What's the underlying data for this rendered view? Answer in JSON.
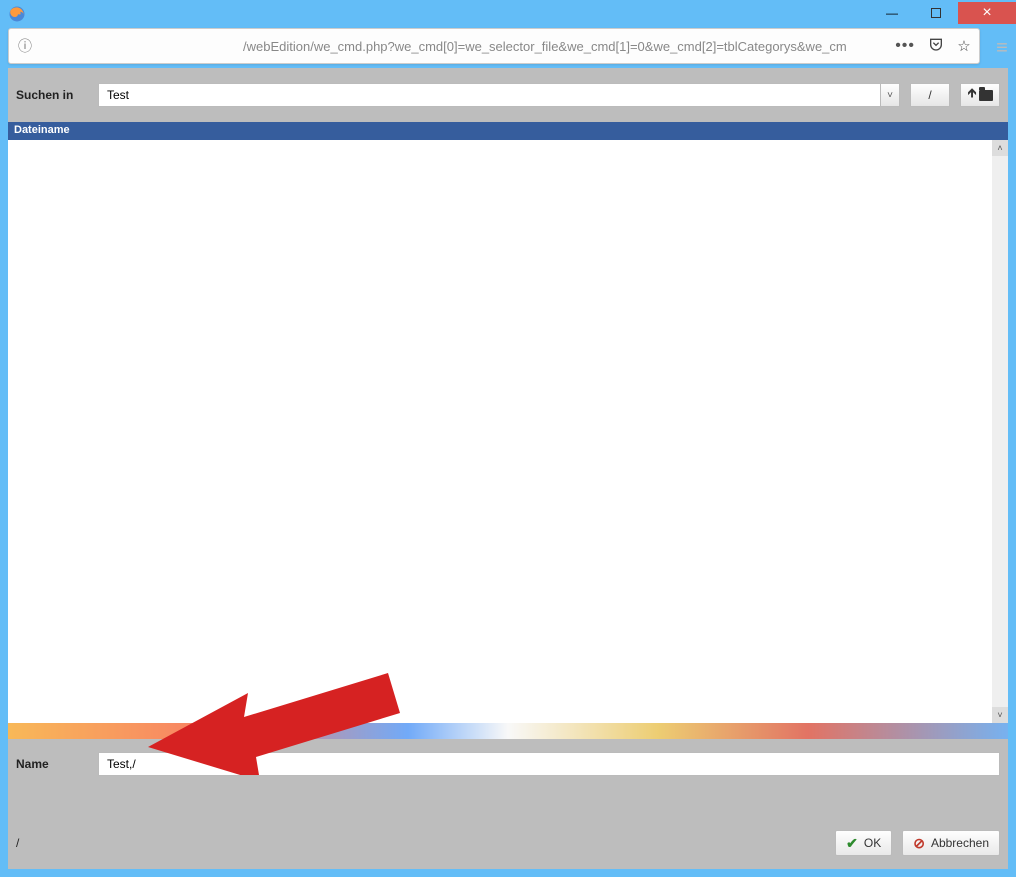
{
  "window": {
    "minimize": "—",
    "close": "×"
  },
  "address": {
    "url": "/webEdition/we_cmd.php?we_cmd[0]=we_selector_file&we_cmd[1]=0&we_cmd[2]=tblCategorys&we_cm",
    "ellipsis": "•••"
  },
  "toolbar": {
    "search_label": "Suchen in",
    "search_value": "Test",
    "root_button": "/",
    "up_arrow": "↥"
  },
  "list": {
    "header_filename": "Dateiname"
  },
  "name": {
    "label": "Name",
    "value": "Test,/"
  },
  "footer": {
    "path": "/",
    "ok": "OK",
    "cancel": "Abbrechen"
  },
  "scroll": {
    "up": "˄",
    "down": "˅"
  }
}
